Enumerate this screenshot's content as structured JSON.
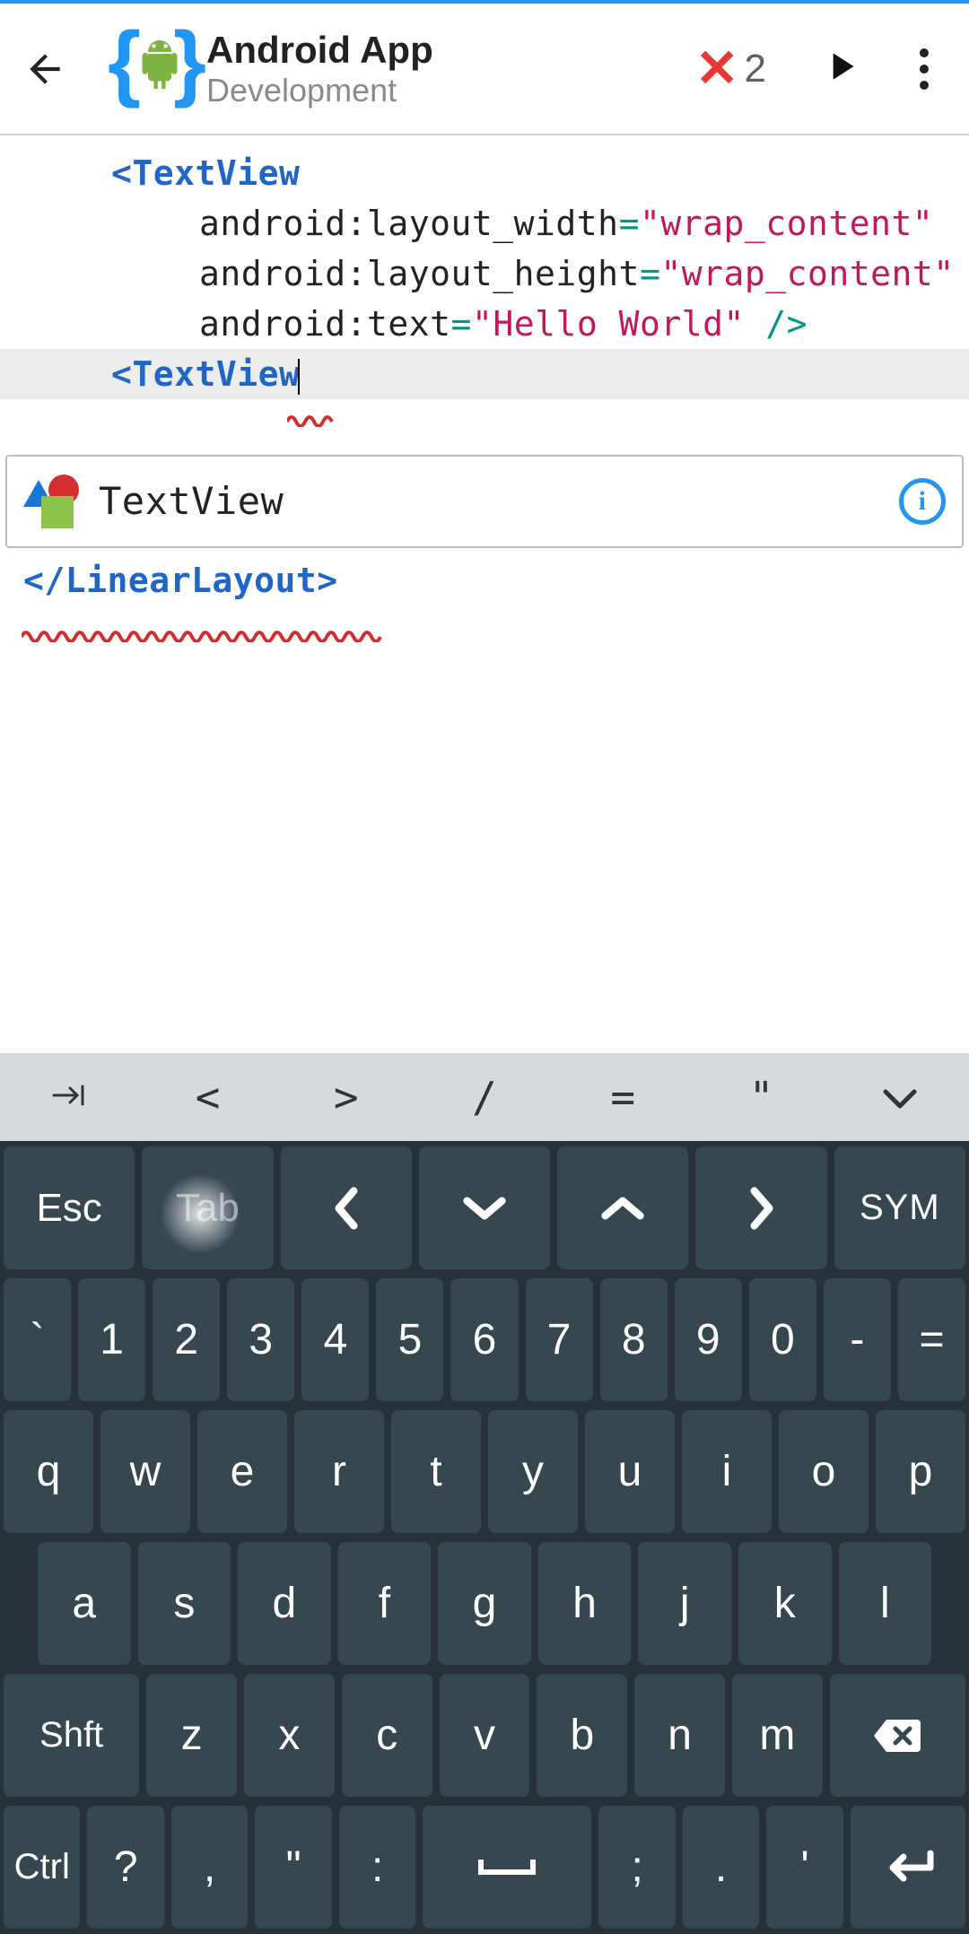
{
  "toolbar": {
    "title": "Android App",
    "subtitle": "Development",
    "error_count": "2"
  },
  "code": {
    "line1_tag": "<TextView",
    "line2_attr": "android:layout_width",
    "line2_val": "\"wrap_content\"",
    "line3_attr": "android:layout_height",
    "line3_val": "\"wrap_content\"",
    "line4_attr": "android:text",
    "line4_val": "\"Hello World\"",
    "line4_end": " />",
    "line5_tag": "<TextView",
    "line6_tag": "</LinearLayout>"
  },
  "suggestion": {
    "label": "TextView"
  },
  "shortcut_row": {
    "k_tab": "→|",
    "k_lt": "<",
    "k_gt": ">",
    "k_slash": "/",
    "k_eq": "=",
    "k_quote": "\"",
    "k_down": "⌄"
  },
  "keyboard": {
    "row0": {
      "esc": "Esc",
      "tab": "Tab",
      "left": "‹",
      "down": "⌄",
      "up": "⌃",
      "right": "›",
      "sym": "SYM"
    },
    "row1": {
      "backtick": "`",
      "k1": "1",
      "k2": "2",
      "k3": "3",
      "k4": "4",
      "k5": "5",
      "k6": "6",
      "k7": "7",
      "k8": "8",
      "k9": "9",
      "k0": "0",
      "dash": "-",
      "eq": "="
    },
    "row2": {
      "q": "q",
      "w": "w",
      "e": "e",
      "r": "r",
      "t": "t",
      "y": "y",
      "u": "u",
      "i": "i",
      "o": "o",
      "p": "p"
    },
    "row3": {
      "a": "a",
      "s": "s",
      "d": "d",
      "f": "f",
      "g": "g",
      "h": "h",
      "j": "j",
      "k": "k",
      "l": "l"
    },
    "row4": {
      "shift": "Shft",
      "z": "z",
      "x": "x",
      "c": "c",
      "v": "v",
      "b": "b",
      "n": "n",
      "m": "m"
    },
    "row5": {
      "ctrl": "Ctrl",
      "qmark": "?",
      "comma": ",",
      "dquote": "\"",
      "colon": ":",
      "space": "⎵",
      "semi": ";",
      "period": ".",
      "squote": "'"
    }
  }
}
